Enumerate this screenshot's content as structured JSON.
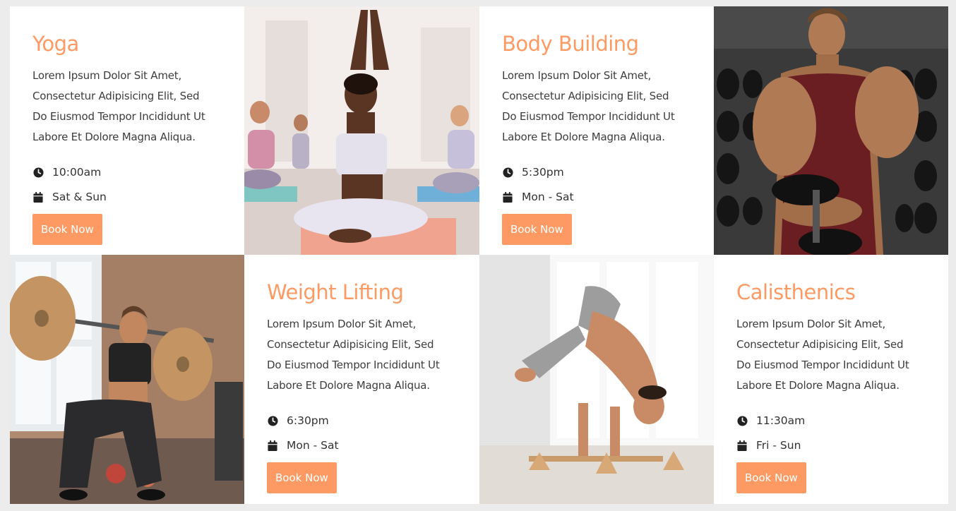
{
  "accent_color": "#fd9a63",
  "classes": [
    {
      "title": "Yoga",
      "description_lines": [
        "Lorem Ipsum Dolor Sit Amet,",
        "Consectetur Adipisicing Elit, Sed",
        "Do Eiusmod Tempor Incididunt Ut",
        "Labore Et Dolore Magna Aliqua."
      ],
      "time": "10:00am",
      "days": "Sat & Sun",
      "button": "Book Now",
      "time_icon": "clock-icon",
      "days_icon": "calendar-icon"
    },
    {
      "title": "Body Building",
      "description_lines": [
        "Lorem Ipsum Dolor Sit Amet,",
        "Consectetur Adipisicing Elit, Sed",
        "Do Eiusmod Tempor Incididunt Ut",
        "Labore Et Dolore Magna Aliqua."
      ],
      "time": "5:30pm",
      "days": "Mon - Sat",
      "button": "Book Now",
      "time_icon": "clock-icon",
      "days_icon": "calendar-icon"
    },
    {
      "title": "Weight Lifting",
      "description_lines": [
        "Lorem Ipsum Dolor Sit Amet,",
        "Consectetur Adipisicing Elit, Sed",
        "Do Eiusmod Tempor Incididunt Ut",
        "Labore Et Dolore Magna Aliqua."
      ],
      "time": "6:30pm",
      "days": "Mon - Sat",
      "button": "Book Now",
      "time_icon": "clock-icon",
      "days_icon": "calendar-icon"
    },
    {
      "title": "Calisthenics",
      "description_lines": [
        "Lorem Ipsum Dolor Sit Amet,",
        "Consectetur Adipisicing Elit, Sed",
        "Do Eiusmod Tempor Incididunt Ut",
        "Labore Et Dolore Magna Aliqua."
      ],
      "time": "11:30am",
      "days": "Fri - Sun",
      "button": "Book Now",
      "time_icon": "clock-icon",
      "days_icon": "calendar-icon"
    }
  ]
}
